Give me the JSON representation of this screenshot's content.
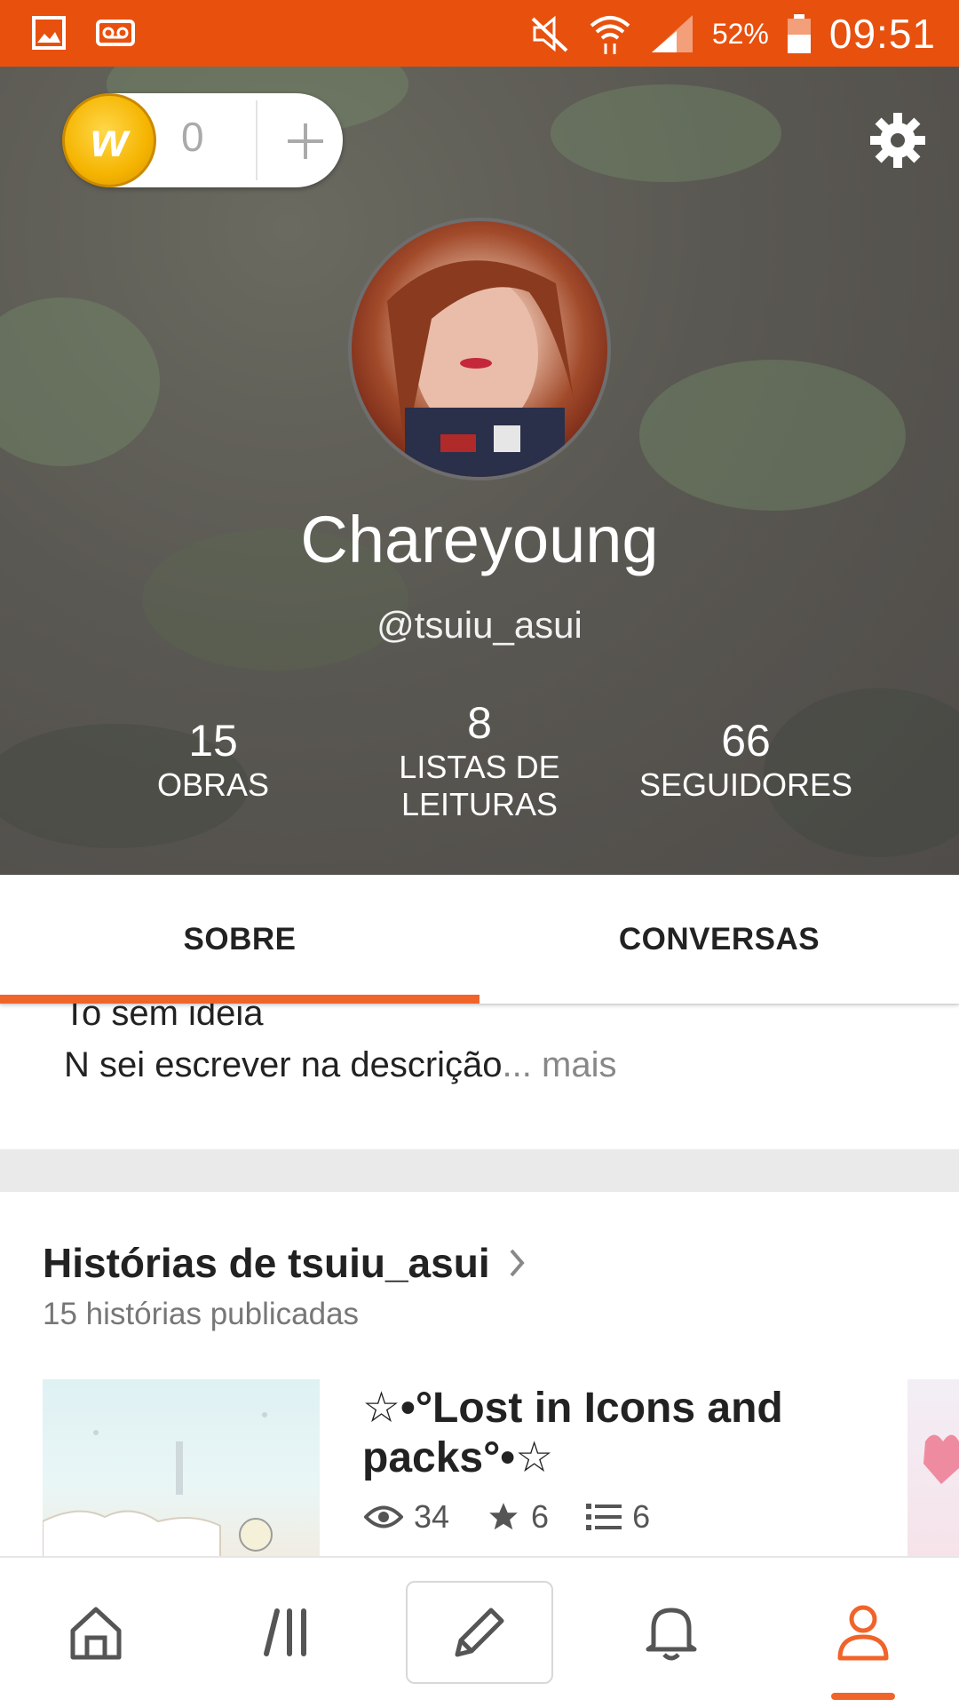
{
  "status_bar": {
    "battery_percent": "52%",
    "time": "09:51",
    "icons": [
      "image-icon",
      "voicemail-icon",
      "mute-icon",
      "wifi-icon",
      "signal-icon",
      "battery-icon"
    ]
  },
  "header": {
    "coins": {
      "count": "0",
      "coin_letter": "w"
    },
    "display_name": "Chareyoung",
    "handle": "@tsuiu_asui",
    "stats": [
      {
        "value": "15",
        "label": "OBRAS"
      },
      {
        "value": "8",
        "label_line1": "LISTAS DE",
        "label_line2": "LEITURAS"
      },
      {
        "value": "66",
        "label": "SEGUIDORES"
      }
    ]
  },
  "tabs": [
    {
      "label": "SOBRE",
      "active": true
    },
    {
      "label": "CONVERSAS",
      "active": false
    }
  ],
  "about": {
    "line1": "To sem ideia",
    "line2": "N sei escrever na descrição",
    "ellipsis": "...",
    "more": "mais"
  },
  "stories": {
    "title": "Histórias de tsuiu_asui",
    "subtitle": "15 histórias publicadas",
    "items": [
      {
        "title": "☆•°Lost in Icons and packs°•☆",
        "reads": "34",
        "votes": "6",
        "parts": "6"
      }
    ]
  },
  "bottom_nav": {
    "items": [
      {
        "name": "home",
        "icon": "home-icon"
      },
      {
        "name": "library",
        "icon": "library-icon"
      },
      {
        "name": "write",
        "icon": "pencil-icon"
      },
      {
        "name": "notifications",
        "icon": "bell-icon"
      },
      {
        "name": "profile",
        "icon": "profile-icon",
        "active": true
      }
    ]
  },
  "colors": {
    "accent": "#e8500e",
    "tab_underline": "#f0642a"
  }
}
